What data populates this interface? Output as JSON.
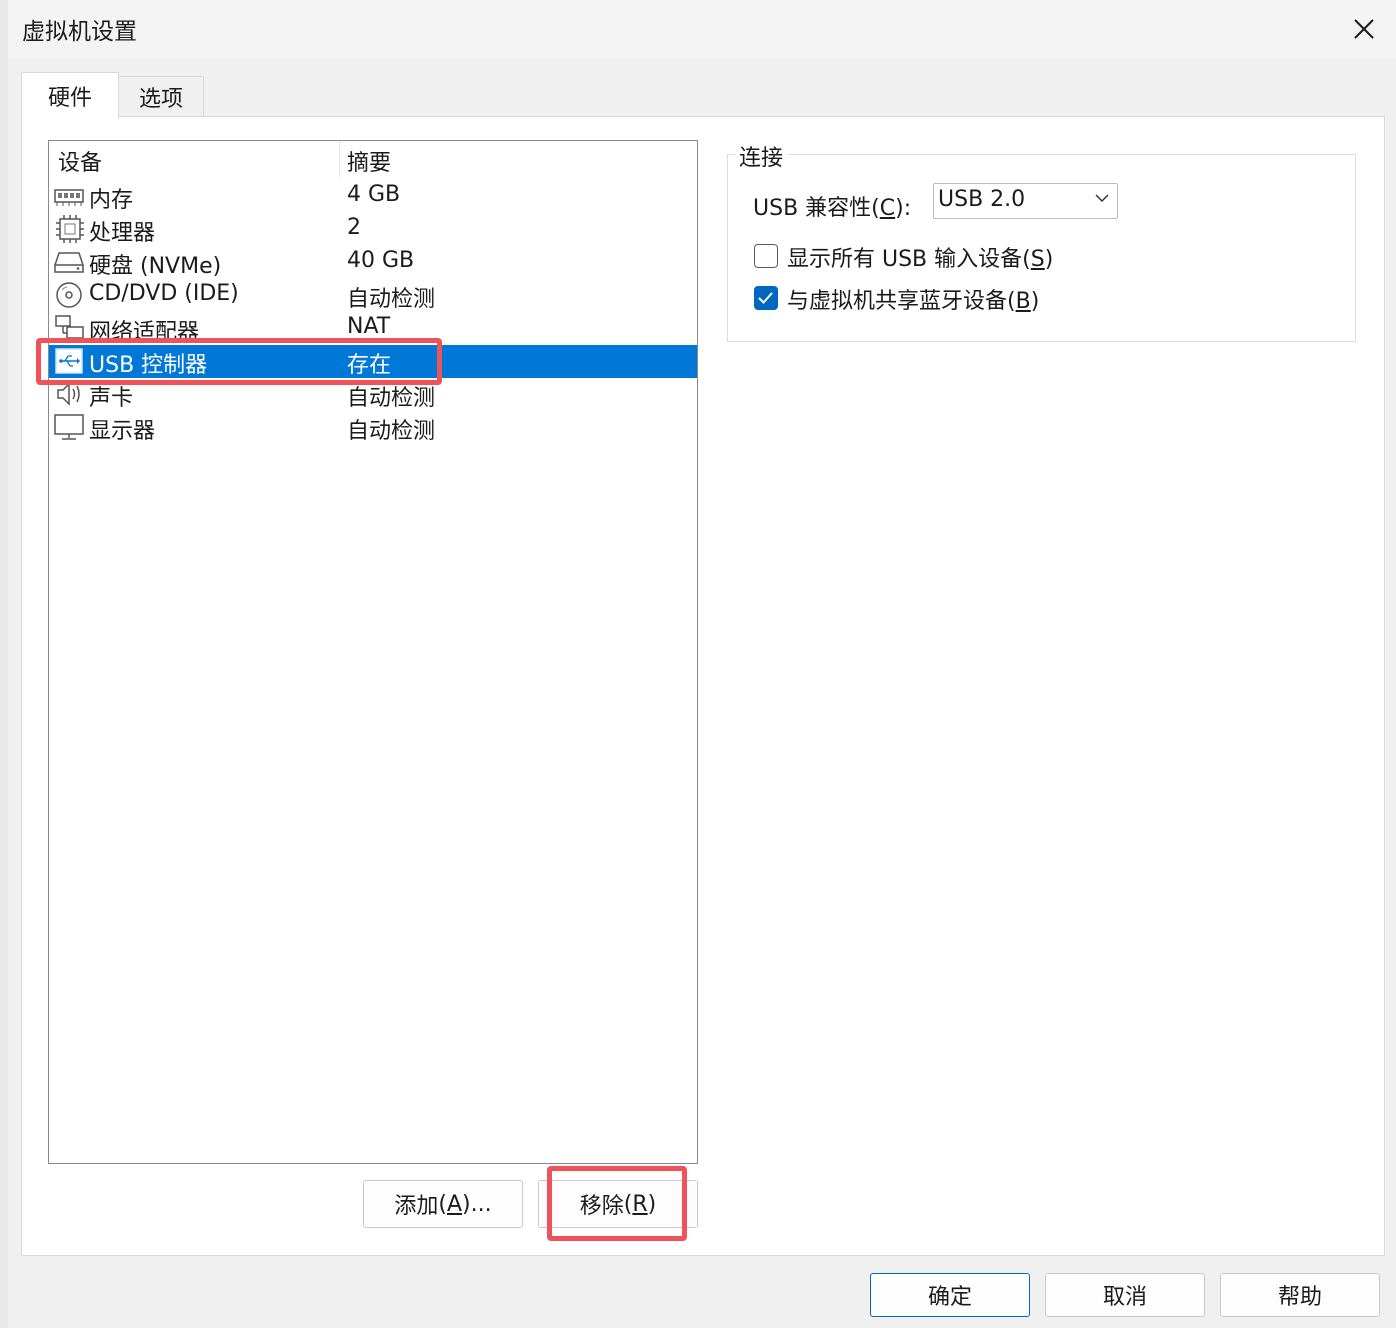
{
  "window": {
    "title": "虚拟机设置",
    "close_icon": "close-icon"
  },
  "tabs": [
    {
      "label": "硬件",
      "active": true
    },
    {
      "label": "选项",
      "active": false
    }
  ],
  "device_table": {
    "headers": {
      "device": "设备",
      "summary": "摘要"
    },
    "rows": [
      {
        "name": "内存",
        "summary": "4 GB",
        "icon": "memory-icon",
        "selected": false
      },
      {
        "name": "处理器",
        "summary": "2",
        "icon": "processor-icon",
        "selected": false
      },
      {
        "name": "硬盘 (NVMe)",
        "summary": "40 GB",
        "icon": "hard-disk-icon",
        "selected": false
      },
      {
        "name": "CD/DVD (IDE)",
        "summary": "自动检测",
        "icon": "cd-dvd-icon",
        "selected": false
      },
      {
        "name": "网络适配器",
        "summary": "NAT",
        "icon": "network-adapter-icon",
        "selected": false
      },
      {
        "name": "USB 控制器",
        "summary": "存在",
        "icon": "usb-icon",
        "selected": true
      },
      {
        "name": "声卡",
        "summary": "自动检测",
        "icon": "speaker-icon",
        "selected": false
      },
      {
        "name": "显示器",
        "summary": "自动检测",
        "icon": "monitor-icon",
        "selected": false
      }
    ]
  },
  "list_buttons": {
    "add": {
      "text": "添加",
      "mnemonic": "A",
      "suffix": "..."
    },
    "remove": {
      "text": "移除",
      "mnemonic": "R",
      "suffix": ""
    }
  },
  "connection": {
    "group_title": "连接",
    "usb_compat_label": {
      "text": "USB 兼容性",
      "mnemonic": "C"
    },
    "usb_compat_value": "USB 2.0",
    "show_all_usb": {
      "text": "显示所有 USB 输入设备",
      "mnemonic": "S",
      "checked": false
    },
    "share_bluetooth": {
      "text": "与虚拟机共享蓝牙设备",
      "mnemonic": "B",
      "checked": true
    }
  },
  "footer_buttons": {
    "ok": "确定",
    "cancel": "取消",
    "help": "帮助"
  },
  "colors": {
    "selection": "#0078d7",
    "highlight_annotation": "#f0525a",
    "checkbox_checked": "#0067c0"
  }
}
